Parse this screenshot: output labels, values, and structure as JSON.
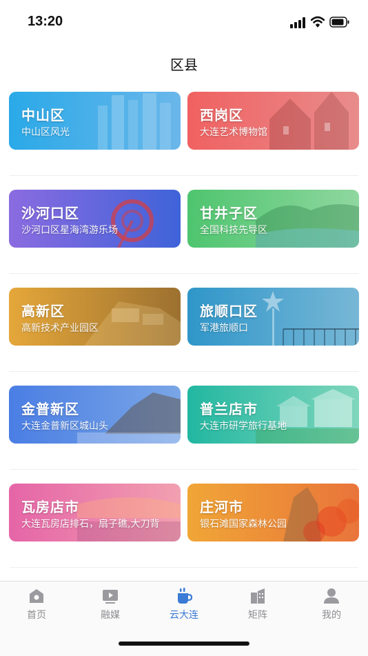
{
  "status_bar": {
    "time": "13:20"
  },
  "header": {
    "title": "区县"
  },
  "districts": [
    {
      "title": "中山区",
      "subtitle": "中山区风光",
      "gradient": [
        "#2aa9e8",
        "#6ab7ea"
      ]
    },
    {
      "title": "西岗区",
      "subtitle": "大连艺术博物馆",
      "gradient": [
        "#f06161",
        "#e98c8c"
      ]
    },
    {
      "title": "沙河口区",
      "subtitle": "沙河口区星海湾游乐场",
      "gradient": [
        "#8b6be0",
        "#3f63d9"
      ]
    },
    {
      "title": "甘井子区",
      "subtitle": "全国科技先导区",
      "gradient": [
        "#4fc56f",
        "#8fd79f"
      ]
    },
    {
      "title": "高新区",
      "subtitle": "高新技术产业园区",
      "gradient": [
        "#e5a73a",
        "#9c7130"
      ]
    },
    {
      "title": "旅顺口区",
      "subtitle": "军港旅顺口",
      "gradient": [
        "#2f96c9",
        "#78b7d6"
      ]
    },
    {
      "title": "金普新区",
      "subtitle": "大连金普新区城山头",
      "gradient": [
        "#4a7ee4",
        "#7aa6e6"
      ]
    },
    {
      "title": "普兰店市",
      "subtitle": "大连市研学旅行基地",
      "gradient": [
        "#22b7a1",
        "#7fd6bc"
      ]
    },
    {
      "title": "瓦房店市",
      "subtitle": "大连瓦房店排石，扇子礁,大刀背",
      "gradient": [
        "#e565a7",
        "#f2a0b0"
      ]
    },
    {
      "title": "庄河市",
      "subtitle": "银石滩国家森林公园",
      "gradient": [
        "#f0a637",
        "#e9743a"
      ]
    }
  ],
  "tab_bar": {
    "items": [
      {
        "label": "首页",
        "icon": "home-icon"
      },
      {
        "label": "融媒",
        "icon": "video-icon"
      },
      {
        "label": "云大连",
        "icon": "cup-icon"
      },
      {
        "label": "矩阵",
        "icon": "buildings-icon"
      },
      {
        "label": "我的",
        "icon": "person-icon"
      }
    ],
    "active": "云大连"
  },
  "colors": {
    "accent": "#3a7bd5",
    "inactive": "#8e8e93"
  }
}
